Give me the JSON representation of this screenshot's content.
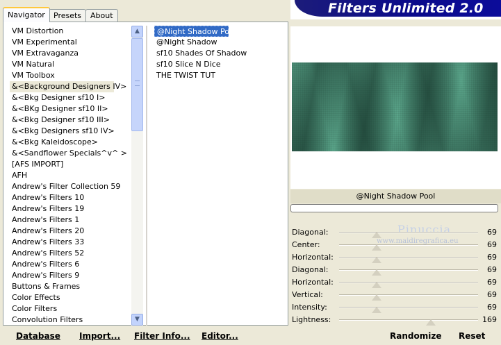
{
  "tabs": [
    {
      "label": "Navigator",
      "active": true
    },
    {
      "label": "Presets",
      "active": false
    },
    {
      "label": "About",
      "active": false
    }
  ],
  "title": "Filters Unlimited 2.0",
  "categories": {
    "selected_index": 5,
    "items": [
      "VM Distortion",
      "VM Experimental",
      "VM Extravaganza",
      "VM Natural",
      "VM Toolbox",
      "&<Background Designers IV>",
      "&<Bkg Designer sf10 I>",
      "&<BKg Designer sf10 II>",
      "&<Bkg Designer sf10 III>",
      "&<Bkg Designers sf10 IV>",
      "&<Bkg Kaleidoscope>",
      "&<Sandflower Specials^v^ >",
      "[AFS IMPORT]",
      "AFH",
      "Andrew's Filter Collection 59",
      "Andrew's Filters 10",
      "Andrew's Filters 19",
      "Andrew's Filters 1",
      "Andrew's Filters 20",
      "Andrew's Filters 33",
      "Andrew's Filters 52",
      "Andrew's Filters 6",
      "Andrew's Filters 9",
      "Buttons & Frames",
      "Color Effects",
      "Color Filters",
      "Convolution Filters"
    ]
  },
  "filters": {
    "selected_index": 0,
    "items": [
      "@Night Shadow Pool",
      "@Night Shadow",
      "sf10 Shades Of Shadow",
      "sf10 Slice N Dice",
      "THE TWIST TUT"
    ]
  },
  "scrollbar": {
    "up_icon": "chevron-up-icon",
    "down_icon": "chevron-down-icon",
    "grip_icon": "grip-icon"
  },
  "filter_name": "@Night Shadow Pool",
  "progress": 0,
  "params": [
    {
      "label": "Diagonal:",
      "value": "69",
      "level": 0.27
    },
    {
      "label": "Center:",
      "value": "69",
      "level": 0.27
    },
    {
      "label": "Horizontal:",
      "value": "69",
      "level": 0.27
    },
    {
      "label": "Diagonal:",
      "value": "69",
      "level": 0.27
    },
    {
      "label": "Horizontal:",
      "value": "69",
      "level": 0.27
    },
    {
      "label": "Vertical:",
      "value": "69",
      "level": 0.27
    },
    {
      "label": "Intensity:",
      "value": "69",
      "level": 0.27
    },
    {
      "label": "Lightness:",
      "value": "169",
      "level": 0.66
    }
  ],
  "watermark": {
    "name": "Pinuccia",
    "url": "www.maidiregrafica.eu"
  },
  "buttons": {
    "database": "Database",
    "import": "Import...",
    "filter_info": "Filter Info...",
    "editor": "Editor...",
    "randomize": "Randomize",
    "reset": "Reset"
  },
  "colors": {
    "selection": "#316ac5",
    "banner": "#0a0a8c",
    "preview_base": "#5aa58a"
  }
}
